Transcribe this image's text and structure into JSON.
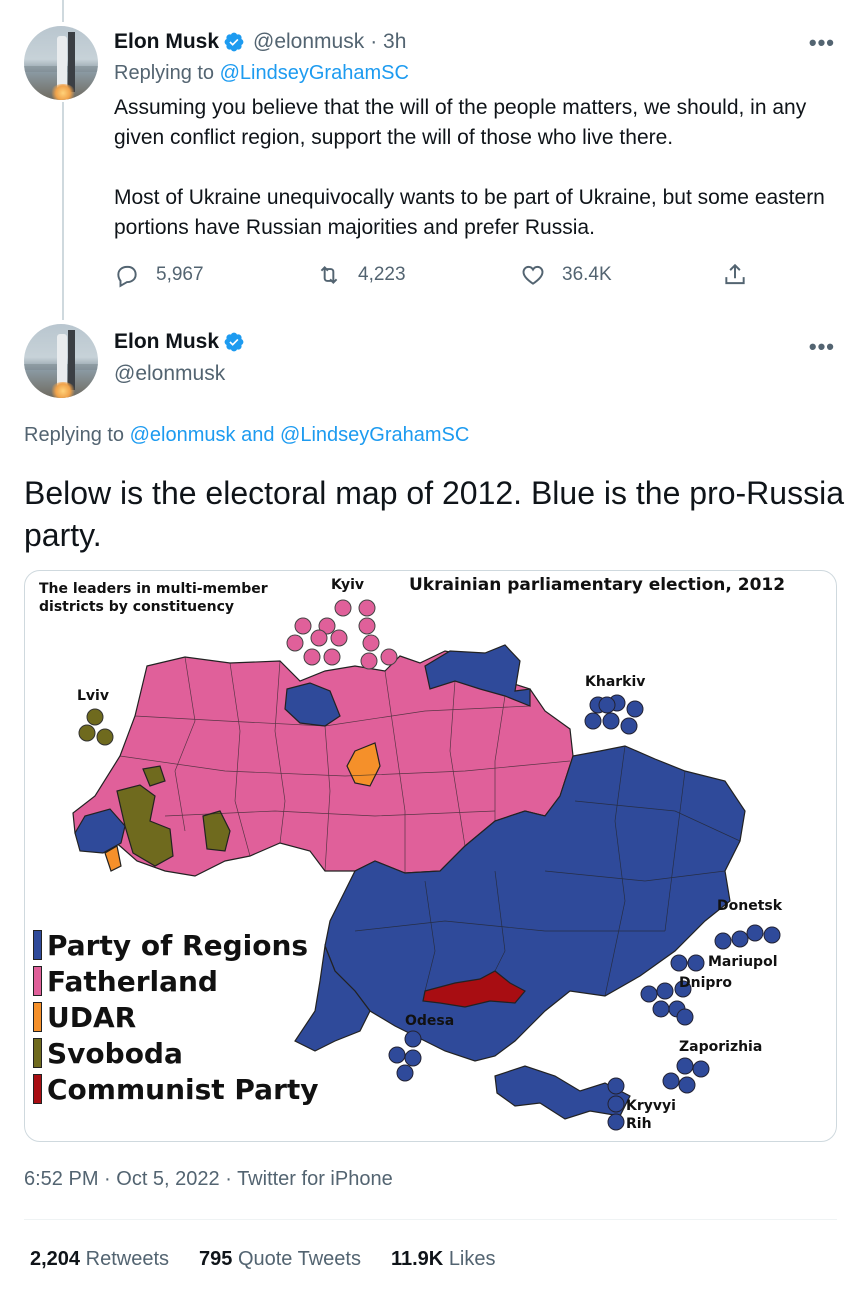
{
  "first_tweet": {
    "name": "Elon Musk",
    "handle": "@elonmusk",
    "time": "· 3h",
    "replying_label": "Replying to",
    "replying_to": "@LindseyGrahamSC",
    "paragraph1": "Assuming you believe that the will of the people matters, we should, in any given conflict region, support the will of those who live there.",
    "paragraph2": "Most of Ukraine unequivocally wants to be part of Ukraine, but some eastern portions have Russian majorities and prefer Russia.",
    "replies": "5,967",
    "retweets": "4,223",
    "likes": "36.4K",
    "more_icon": "more-icon"
  },
  "main_tweet": {
    "name": "Elon Musk",
    "handle": "@elonmusk",
    "replying_label": "Replying to",
    "replying_to_1": "@elonmusk",
    "and_label": "and",
    "replying_to_2": "@LindseyGrahamSC",
    "text": "Below is the electoral map of 2012. Blue is the pro-Russia party.",
    "timestamp": "6:52 PM · Oct 5, 2022 · Twitter for iPhone",
    "retweets_count": "2,204",
    "retweets_label": "Retweets",
    "quote_count": "795",
    "quote_label": "Quote Tweets",
    "likes_count": "11.9K",
    "likes_label": "Likes"
  },
  "map": {
    "title": "Ukrainian parliamentary election, 2012",
    "subtitle_line1": "The leaders in multi-member",
    "subtitle_line2": "districts by constituency",
    "cities": {
      "kyiv": "Kyiv",
      "lviv": "Lviv",
      "kharkiv": "Kharkiv",
      "donetsk": "Donetsk",
      "mariupol": "Mariupol",
      "dnipro": "Dnipro",
      "odesa": "Odesa",
      "zaporizhia": "Zaporizhia",
      "kryvyi": "Kryvyi",
      "rih": "Rih"
    },
    "legend": [
      {
        "label": "Party of Regions",
        "color": "#2f4a9a"
      },
      {
        "label": "Fatherland",
        "color": "#e0609a"
      },
      {
        "label": "UDAR",
        "color": "#f5902a"
      },
      {
        "label": "Svoboda",
        "color": "#6f6a1e"
      },
      {
        "label": "Communist Party",
        "color": "#a80d12"
      }
    ]
  },
  "colors": {
    "accent": "#1d9bf0",
    "secondary_text": "#536471",
    "regions_blue": "#2f4a9a",
    "fatherland_pink": "#e0609a"
  }
}
